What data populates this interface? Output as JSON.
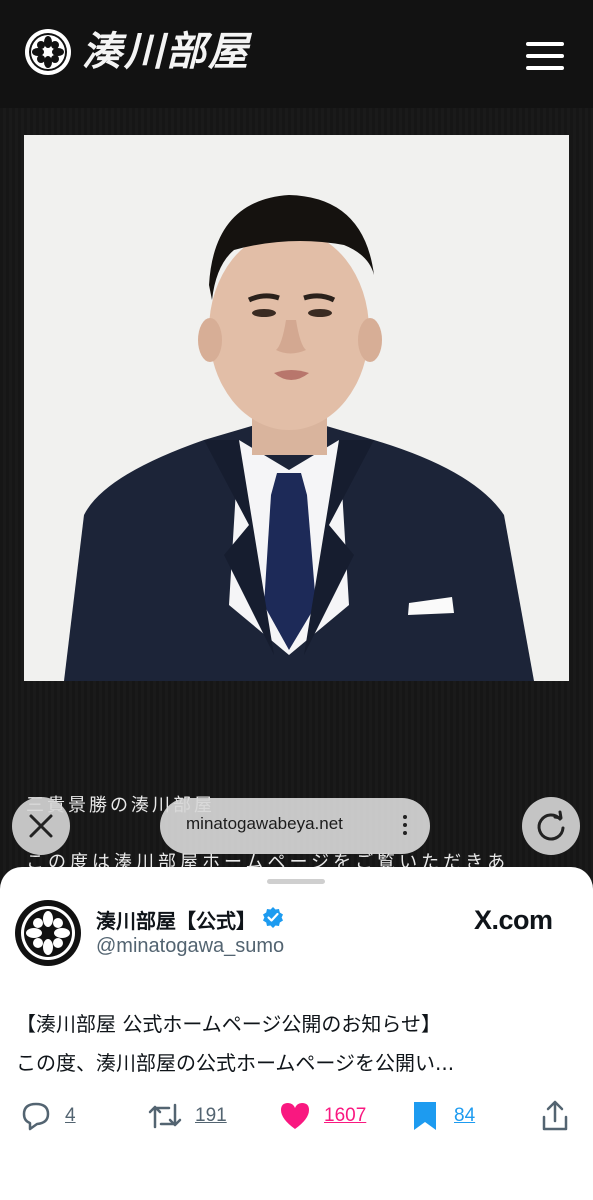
{
  "site": {
    "name": "湊川部屋"
  },
  "article": {
    "title": "三貴景勝の湊川部屋",
    "body": "この度は湊川部屋ホームページをご覧いただきあ"
  },
  "browser": {
    "url": "minatogawabeya.net"
  },
  "tweet": {
    "display_name": "湊川部屋【公式】",
    "handle": "@minatogawa_sumo",
    "source": "X.com",
    "line1": "【湊川部屋 公式ホームページ公開のお知らせ】",
    "line2": "この度、湊川部屋の公式ホームページを公開い...",
    "replies": "4",
    "retweets": "191",
    "likes": "1607",
    "bookmarks": "84",
    "colors": {
      "like": "#f91880",
      "bookmark": "#1d9bf0",
      "verified": "#1d9bf0",
      "icon": "#536471"
    }
  }
}
